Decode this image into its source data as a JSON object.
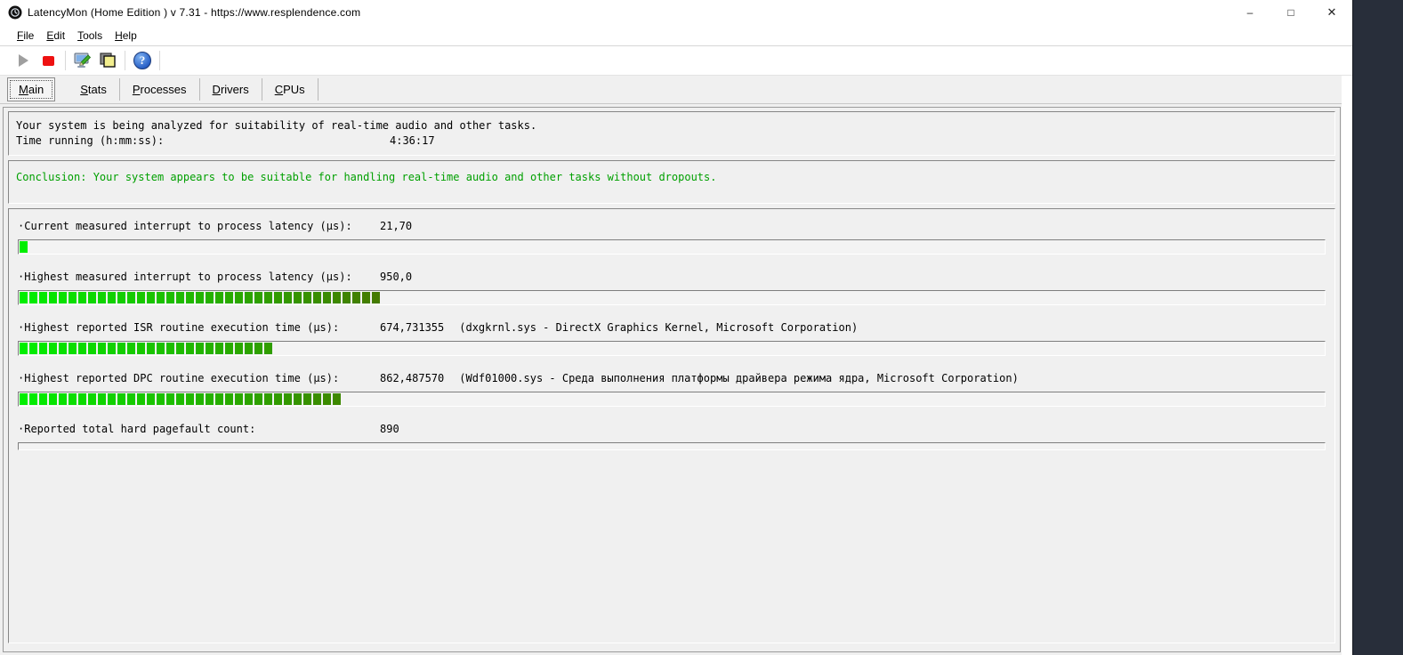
{
  "window": {
    "title": "LatencyMon  (Home Edition )  v 7.31 - https://www.resplendence.com",
    "controls": {
      "minimize": "–",
      "maximize": "□",
      "close": "✕"
    }
  },
  "menu": {
    "items": [
      {
        "id": "file",
        "label": "File"
      },
      {
        "id": "edit",
        "label": "Edit"
      },
      {
        "id": "tools",
        "label": "Tools"
      },
      {
        "id": "help",
        "label": "Help"
      }
    ]
  },
  "toolbar": {
    "icons": [
      "play-icon",
      "stop-icon",
      "analyze-icon",
      "copy-icon",
      "help-icon"
    ],
    "help_glyph": "?"
  },
  "tabs": {
    "items": [
      {
        "id": "main",
        "label": "Main"
      },
      {
        "id": "stats",
        "label": "Stats"
      },
      {
        "id": "processes",
        "label": "Processes"
      },
      {
        "id": "drivers",
        "label": "Drivers"
      },
      {
        "id": "cpus",
        "label": "CPUs"
      }
    ],
    "selected": "main"
  },
  "status": {
    "line1": "Your system is being analyzed for suitability of real-time audio and other tasks.",
    "time_label": "Time running (h:mm:ss):",
    "time_value": "4:36:17"
  },
  "conclusion": {
    "text": "Conclusion: Your system appears to be suitable for handling real-time audio and other tasks without dropouts.",
    "color": "#00a000"
  },
  "chart_data": {
    "type": "bar",
    "title": "Latency measurements (segmented indicator bars)",
    "bar_color_start": "#00ee00",
    "bar_color_end": "#4c6e00",
    "max_segments_scale": 40,
    "measurements": [
      {
        "label": "·Current measured interrupt to process latency (µs):",
        "value": "21,70",
        "detail": "",
        "segments": 1,
        "bar_style": "normal"
      },
      {
        "label": "·Highest measured interrupt to process latency (µs):",
        "value": "950,0",
        "detail": "",
        "segments": 37,
        "bar_style": "normal"
      },
      {
        "label": "·Highest reported ISR routine execution time (µs):",
        "value": "674,731355",
        "detail": "(dxgkrnl.sys - DirectX Graphics Kernel, Microsoft Corporation)",
        "segments": 26,
        "bar_style": "normal"
      },
      {
        "label": "·Highest reported DPC routine execution time (µs):",
        "value": "862,487570",
        "detail": "(Wdf01000.sys - Среда выполнения платформы драйвера режима ядра, Microsoft Corporation)",
        "segments": 33,
        "bar_style": "normal"
      },
      {
        "label": "·Reported total hard pagefault count:",
        "value": "890",
        "detail": "",
        "segments": 0,
        "bar_style": "thin"
      }
    ]
  }
}
